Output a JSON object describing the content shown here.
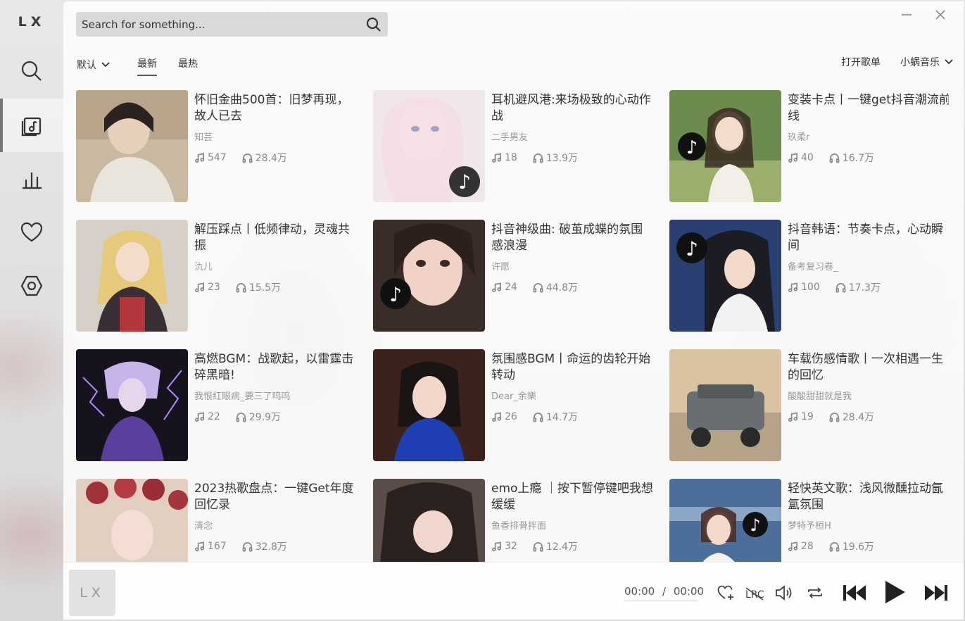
{
  "app": {
    "logo": "LX",
    "player_logo": "LX"
  },
  "sidebar": {
    "items": [
      {
        "name": "search",
        "icon": "search-icon"
      },
      {
        "name": "songlist",
        "icon": "songlist-icon",
        "active": true
      },
      {
        "name": "leaderboard",
        "icon": "chart-icon"
      },
      {
        "name": "favorites",
        "icon": "heart-icon"
      },
      {
        "name": "settings",
        "icon": "settings-icon"
      }
    ]
  },
  "search": {
    "placeholder": "Search for something..."
  },
  "filters": {
    "sort_label": "默认",
    "tabs": [
      {
        "label": "最新",
        "active": true
      },
      {
        "label": "最热",
        "active": false
      }
    ],
    "open_playlist": "打开歌单",
    "source": "小蜗音乐"
  },
  "playlists": [
    {
      "title": "怀旧金曲500首：旧梦再现，故人已去",
      "author": "知芸",
      "songs": "547",
      "plays": "28.4万"
    },
    {
      "title": "耳机避风港:来场极致的心动作战",
      "author": "二手男友",
      "songs": "18",
      "plays": "13.9万"
    },
    {
      "title": "变装卡点丨一键get抖音潮流前线",
      "author": "玖柔r",
      "songs": "40",
      "plays": "16.7万"
    },
    {
      "title": "解压踩点丨低频律动，灵魂共振",
      "author": "氿儿",
      "songs": "23",
      "plays": "15.5万"
    },
    {
      "title": "抖音神级曲: 破茧成蝶的氛围感浪漫",
      "author": "许愿",
      "songs": "24",
      "plays": "44.8万"
    },
    {
      "title": "抖音韩语：节奏卡点，心动瞬间",
      "author": "备考复习卷_",
      "songs": "100",
      "plays": "17.3万"
    },
    {
      "title": "高燃BGM：战歌起，以雷霆击碎黑暗!",
      "author": "我恨红眼病_要三了呜呜",
      "songs": "22",
      "plays": "29.9万"
    },
    {
      "title": "氛围感BGM丨命运的齿轮开始转动",
      "author": "Dear_余樂",
      "songs": "26",
      "plays": "14.7万"
    },
    {
      "title": "车载伤感情歌丨一次相遇一生的回忆",
      "author": "酸酸甜甜就是我",
      "songs": "19",
      "plays": "28.4万"
    },
    {
      "title": "2023热歌盘点：一键Get年度回忆录",
      "author": "清念",
      "songs": "167",
      "plays": "32.8万"
    },
    {
      "title": "emo上瘾 ｜按下暂停键吧我想缓缓",
      "author": "鱼香排骨拌面",
      "songs": "32",
      "plays": "12.4万"
    },
    {
      "title": "轻快英文歌：浅风微醺拉动氤氲氛围",
      "author": "梦特予桓H",
      "songs": "28",
      "plays": "19.6万"
    }
  ],
  "player": {
    "current_time": "00:00",
    "separator": "/",
    "total_time": "00:00"
  },
  "colors": {
    "accent": "#333333",
    "muted": "#888888",
    "panel": "#ffffff"
  }
}
